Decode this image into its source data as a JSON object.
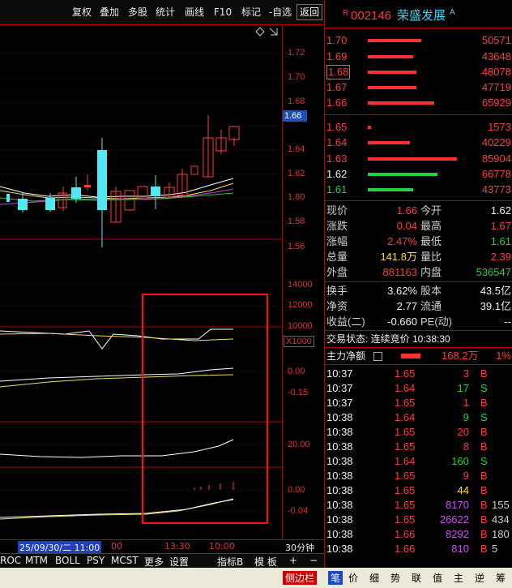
{
  "toolbar": {
    "buttons": [
      "复权",
      "叠加",
      "多股",
      "统计",
      "画线",
      "F10",
      "标记",
      "-自选",
      "返回"
    ]
  },
  "price_axis": [
    "1.72",
    "1.70",
    "1.68",
    "1.66",
    "1.64",
    "1.62",
    "1.60",
    "1.58",
    "1.56"
  ],
  "current_price_tag": "1.66",
  "volume_axis": [
    "14000",
    "12000",
    "10000"
  ],
  "volume_unit": "X1000",
  "ind1_axis": [
    "0.00",
    "-0.15"
  ],
  "ind2_axis": [
    "20.00"
  ],
  "ind3_axis": [
    "0.00",
    "-0.04"
  ],
  "time_axis": {
    "highlight": "25/09/30/二 11:00",
    "t1": "00",
    "t2": "13:30",
    "t3": "10:00",
    "period": "30分钟"
  },
  "bottom_tabs": [
    "ROC",
    "MTM",
    "BOLL",
    "PSY",
    "MCST",
    "更多",
    "设置",
    "指标B",
    "模 板",
    "+",
    "−"
  ],
  "stock": {
    "badge": "R",
    "code": "002146",
    "name": "荣盛发展",
    "suffix": "A"
  },
  "asks": [
    {
      "price": "1.70",
      "vol": "50571"
    },
    {
      "price": "1.69",
      "vol": "43648"
    },
    {
      "price": "1.68",
      "vol": "48078"
    },
    {
      "price": "1.67",
      "vol": "47719"
    },
    {
      "price": "1.66",
      "vol": "65929"
    }
  ],
  "bids": [
    {
      "price": "1.65",
      "vol": "1573"
    },
    {
      "price": "1.64",
      "vol": "40229"
    },
    {
      "price": "1.63",
      "vol": "85904"
    },
    {
      "price": "1.62",
      "vol": "66778"
    },
    {
      "price": "1.61",
      "vol": "43773"
    }
  ],
  "quote": {
    "l1": "现价",
    "v1": "1.66",
    "l2": "今开",
    "v2": "1.62",
    "l3": "涨跌",
    "v3": "0.04",
    "l4": "最高",
    "v4": "1.67",
    "l5": "涨幅",
    "v5": "2.47%",
    "l6": "最低",
    "v6": "1.61",
    "l7": "总量",
    "v7": "141.8万",
    "l8": "量比",
    "v8": "2.39",
    "l9": "外盘",
    "v9": "881163",
    "l10": "内盘",
    "v10": "536547"
  },
  "fin": {
    "l1": "换手",
    "v1": "3.62%",
    "l2": "股本",
    "v2": "43.5亿",
    "l3": "净资",
    "v3": "2.77",
    "l4": "流通",
    "v4": "39.1亿",
    "l5": "收益(二)",
    "v5": "-0.660",
    "l6": "PE(动)",
    "v6": "--"
  },
  "trade_status": "交易状态: 连续竞价 10:38:30",
  "main_flow": {
    "label": "主力净额",
    "value": "168.2万",
    "pct": "1%"
  },
  "ticks": [
    {
      "t": "10:37",
      "p": "1.65",
      "v": "3",
      "d": "B"
    },
    {
      "t": "10:37",
      "p": "1.64",
      "v": "17",
      "d": "S"
    },
    {
      "t": "10:37",
      "p": "1.65",
      "v": "1",
      "d": "B"
    },
    {
      "t": "10:38",
      "p": "1.64",
      "v": "9",
      "d": "S"
    },
    {
      "t": "10:38",
      "p": "1.65",
      "v": "20",
      "d": "B"
    },
    {
      "t": "10:38",
      "p": "1.65",
      "v": "8",
      "d": "B"
    },
    {
      "t": "10:38",
      "p": "1.64",
      "v": "160",
      "d": "S"
    },
    {
      "t": "10:38",
      "p": "1.65",
      "v": "9",
      "d": "B"
    },
    {
      "t": "10:38",
      "p": "1.65",
      "v": "44",
      "d": "B"
    },
    {
      "t": "10:38",
      "p": "1.65",
      "v": "8170",
      "d": "B",
      "n": "155"
    },
    {
      "t": "10:38",
      "p": "1.65",
      "v": "26622",
      "d": "B",
      "n": "434"
    },
    {
      "t": "10:38",
      "p": "1.66",
      "v": "8292",
      "d": "B",
      "n": "180"
    },
    {
      "t": "10:38",
      "p": "1.66",
      "v": "810",
      "d": "B",
      "n": "5"
    }
  ],
  "sidebar": [
    "侧边栏",
    "笔",
    "价",
    "细",
    "势",
    "联",
    "值",
    "主",
    "逆",
    "筹"
  ],
  "colors": {
    "up": "#ff3b3b",
    "down": "#23d13d",
    "border": "#b00000",
    "candle_down": "#54e8f2"
  }
}
